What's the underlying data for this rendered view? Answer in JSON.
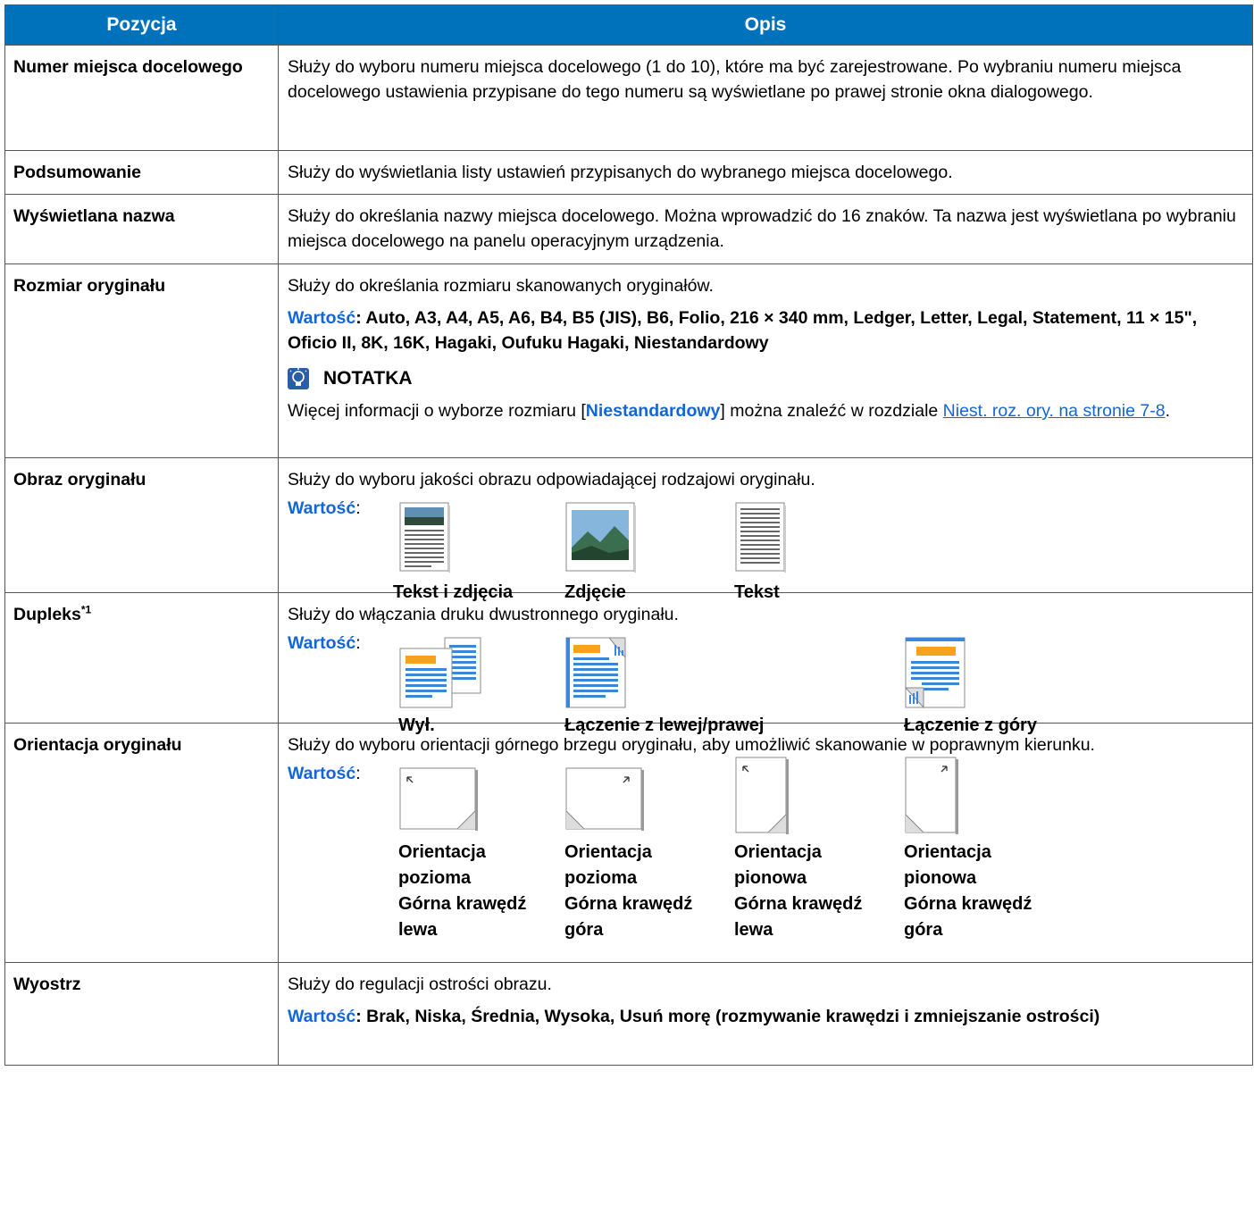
{
  "header": {
    "col1": "Pozycja",
    "col2": "Opis"
  },
  "rows": {
    "numer": {
      "name": "Numer miejsca docelowego",
      "desc": "Służy do wyboru numeru miejsca docelowego (1 do 10), które ma być zarejestrowane. Po wybraniu numeru miejsca docelowego ustawienia przypisane do tego numeru są wyświetlane po prawej stronie okna dialogowego."
    },
    "podsumowanie": {
      "name": "Podsumowanie",
      "desc": "Służy do wyświetlania listy ustawień przypisanych do wybranego miejsca docelowego."
    },
    "nazwa": {
      "name": "Wyświetlana nazwa",
      "desc": "Służy do określania nazwy miejsca docelowego. Można wprowadzić do 16 znaków. Ta nazwa jest wyświetlana po wybraniu miejsca docelowego na panelu operacyjnym urządzenia."
    },
    "rozmiar": {
      "name": "Rozmiar oryginału",
      "desc": "Służy do określania rozmiaru skanowanych oryginałów.",
      "value_label": "Wartość",
      "value_text": ": Auto, A3, A4, A5, A6, B4, B5 (JIS), B6, Folio, 216 × 340 mm, Ledger, Letter, Legal, Statement, 11 × 15\", Oficio II, 8K, 16K, Hagaki, Oufuku Hagaki, Niestandardowy",
      "note_label": "NOTATKA",
      "note_pre": "Więcej informacji o wyborze rozmiaru [",
      "note_kw": "Niestandardowy",
      "note_mid": "] można znaleźć w rozdziale ",
      "note_link": "Niest. roz. ory. na stronie 7-8",
      "note_end": "."
    },
    "obraz": {
      "name": "Obraz oryginału",
      "desc": "Służy do wyboru jakości obrazu odpowiadającej rodzajowi oryginału.",
      "value_label": "Wartość",
      "value_colon": ":",
      "options": [
        "Tekst i zdjęcia",
        "Zdjęcie",
        "Tekst"
      ]
    },
    "dupleks": {
      "name": "Dupleks",
      "sup": "*1",
      "desc": "Służy do włączania druku dwustronnego oryginału.",
      "value_label": "Wartość",
      "value_colon": ":",
      "options": [
        "Wył.",
        "Łączenie z lewej/prawej",
        "Łączenie z góry"
      ]
    },
    "orientacja": {
      "name": "Orientacja oryginału",
      "desc": "Służy do wyboru orientacji górnego brzegu oryginału, aby umożliwić skanowanie w poprawnym kierunku.",
      "value_label": "Wartość",
      "value_colon": ":",
      "options": [
        [
          "Orientacja",
          "pozioma",
          "Górna krawędź",
          "lewa"
        ],
        [
          "Orientacja",
          "pozioma",
          "Górna krawędź",
          "góra"
        ],
        [
          "Orientacja",
          "pionowa",
          "Górna krawędź",
          "lewa"
        ],
        [
          "Orientacja",
          "pionowa",
          "Górna krawędź",
          "góra"
        ]
      ]
    },
    "wyostrz": {
      "name": "Wyostrz",
      "desc": "Służy do regulacji ostrości obrazu.",
      "value_label": "Wartość",
      "value_text": ": Brak, Niska, Średnia, Wysoka, Usuń morę (rozmywanie krawędzi i zmniejszanie ostrości)"
    }
  },
  "colors": {
    "header_bg": "#0072bc",
    "accent": "#1466d6",
    "orange": "#f7a21b",
    "blue_lines": "#3a86d8"
  }
}
